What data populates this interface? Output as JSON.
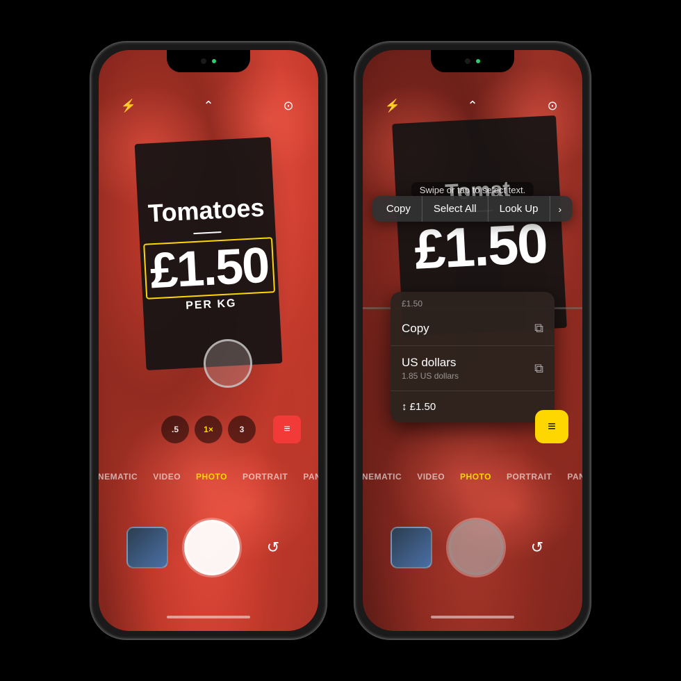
{
  "page": {
    "background": "#000000"
  },
  "phone1": {
    "sign": {
      "title": "Tomatoes",
      "price": "£1.50",
      "unit": "PER KG"
    },
    "camera": {
      "modes": [
        "CINEMATIC",
        "VIDEO",
        "PHOTO",
        "PORTRAIT",
        "PANO"
      ],
      "active_mode": "PHOTO",
      "zoom_levels": [
        ".5",
        "1×",
        "3"
      ],
      "active_zoom": "1×"
    },
    "controls": {
      "flash_icon": "⚡",
      "settings_icon": "○",
      "chevron_icon": "⌃",
      "flip_icon": "↺"
    }
  },
  "phone2": {
    "sign": {
      "title": "Tomat",
      "price": "£1.50"
    },
    "swipe_hint": "Swipe or tap to select text.",
    "context_menu": {
      "buttons": [
        "Copy",
        "Select All",
        "Look Up"
      ],
      "more": "›"
    },
    "dropdown": {
      "header": "£1.50",
      "items": [
        {
          "main": "Copy",
          "sub": "",
          "icon": "⧉"
        },
        {
          "main": "US dollars",
          "sub": "1.85 US dollars",
          "icon": "⧉"
        }
      ],
      "footer": "↕ £1.50"
    },
    "camera": {
      "modes": [
        "CINEMATIC",
        "VIDEO",
        "PHOTO",
        "PORTRAIT",
        "PANO"
      ],
      "active_mode": "PHOTO"
    },
    "live_text_badge": "≡"
  }
}
